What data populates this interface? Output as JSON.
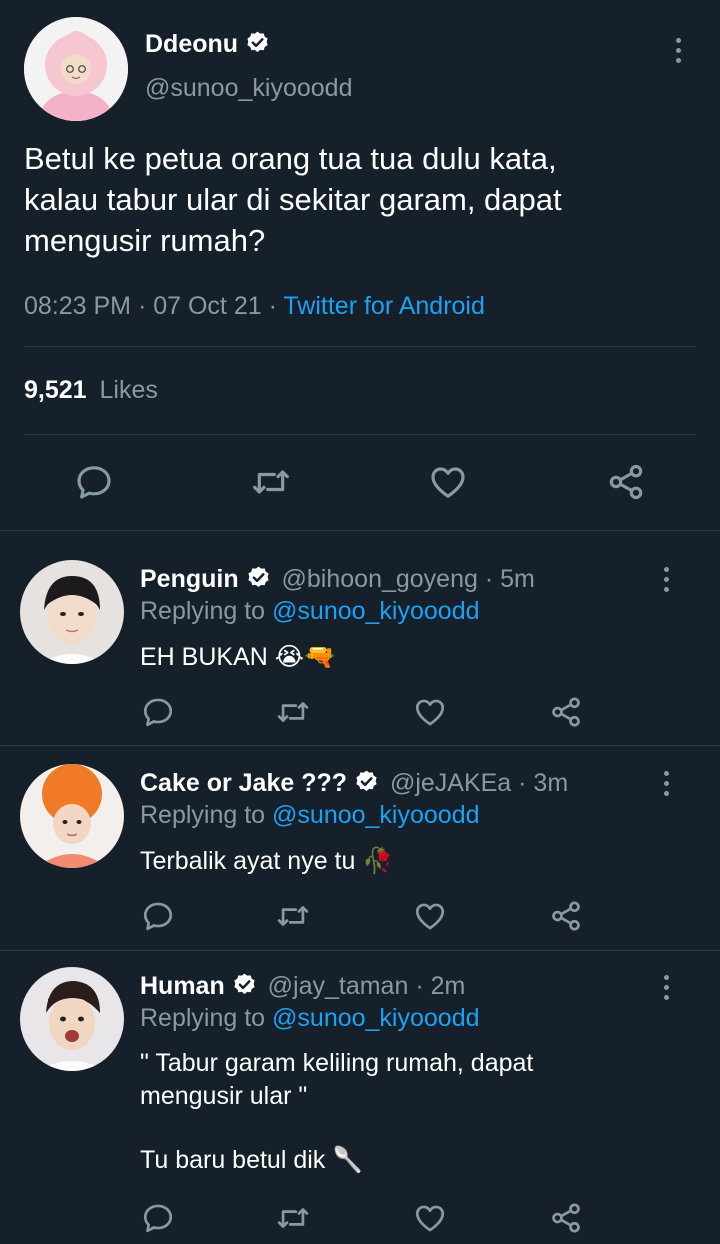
{
  "main_tweet": {
    "display_name": "Ddeonu",
    "handle": "@sunoo_kiyooodd",
    "text_lines": [
      "Betul ke petua orang tua tua dulu kata,",
      "kalau tabur ular di sekitar garam, dapat",
      "mengusir rumah?"
    ],
    "time": "08:23 PM",
    "date": "07 Oct 21",
    "sep": " · ",
    "source": "Twitter for Android",
    "likes_count": "9,521",
    "likes_label": "Likes"
  },
  "replies": [
    {
      "display_name": "Penguin",
      "handle": "@bihoon_goyeng",
      "time": "· 5m",
      "replying_label": "Replying to",
      "replying_to": "@sunoo_kiyooodd",
      "text_lines": [
        "EH BUKAN 😭🔫"
      ]
    },
    {
      "display_name": "Cake or Jake ???",
      "handle": "@jeJAKEa",
      "time": "· 3m",
      "replying_label": "Replying to",
      "replying_to": "@sunoo_kiyooodd",
      "text_lines": [
        "Terbalik ayat nye tu 🥀"
      ]
    },
    {
      "display_name": "Human",
      "handle": "@jay_taman",
      "time": "· 2m",
      "replying_label": "Replying to",
      "replying_to": "@sunoo_kiyooodd",
      "text_lines": [
        "\" Tabur garam keliling rumah, dapat",
        "mengusir ular \"",
        "",
        "Tu baru betul dik 🥄"
      ]
    }
  ],
  "colors": {
    "background": "#15202b",
    "muted": "#8899a6",
    "link": "#1da1f2",
    "divider": "#2f3b47"
  },
  "icons": [
    "verified-icon",
    "more-icon",
    "reply-icon",
    "retweet-icon",
    "like-icon",
    "share-icon"
  ]
}
